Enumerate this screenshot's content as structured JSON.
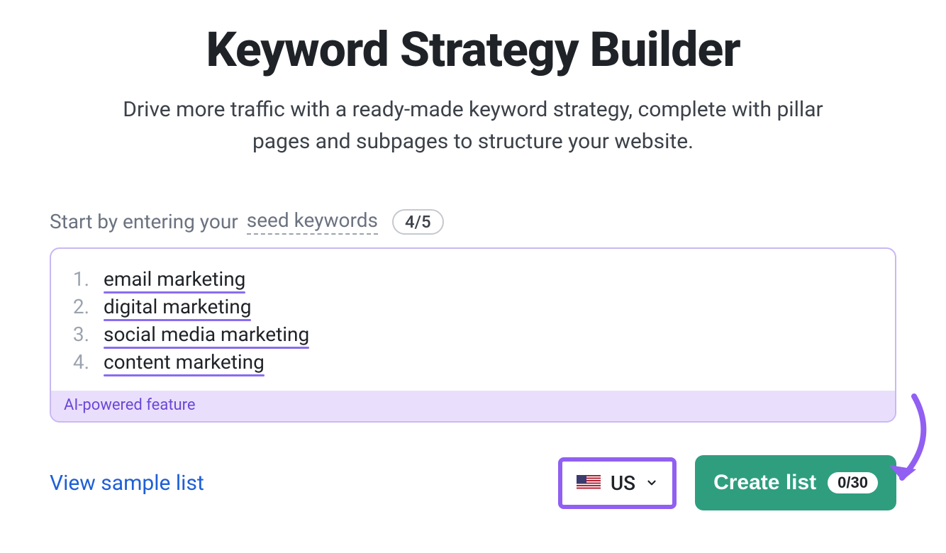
{
  "header": {
    "title": "Keyword Strategy Builder",
    "subtitle": "Drive more traffic with a ready-made keyword strategy, complete with pillar pages and subpages to structure your website."
  },
  "prompt": {
    "prefix": "Start by entering your ",
    "link_text": "seed keywords",
    "count": "4/5"
  },
  "keywords": [
    "email marketing",
    "digital marketing",
    "social media marketing",
    "content marketing"
  ],
  "ai_label": "AI-powered feature",
  "footer": {
    "sample_link": "View sample list",
    "country": {
      "code": "US"
    },
    "create_button": {
      "label": "Create list",
      "badge": "0/30"
    }
  }
}
